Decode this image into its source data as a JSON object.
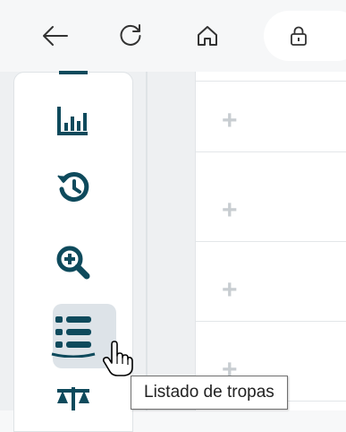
{
  "browser": {
    "icons": {
      "back": "arrow-left-icon",
      "reload": "reload-icon",
      "home": "home-icon",
      "lock": "lock-icon"
    }
  },
  "sidebar": {
    "items": [
      {
        "icon": "bar-chart-icon"
      },
      {
        "icon": "history-icon"
      },
      {
        "icon": "zoom-in-icon"
      },
      {
        "icon": "list-icon",
        "active": true
      },
      {
        "icon": "scale-icon"
      }
    ],
    "accent": "#0e4a5c",
    "active_bg": "#dde3e8"
  },
  "content": {
    "rows": [
      {
        "icon": "plus-icon"
      },
      {
        "icon": "plus-icon"
      },
      {
        "icon": "plus-icon"
      },
      {
        "icon": "plus-icon"
      }
    ]
  },
  "tooltip": {
    "text": "Listado de tropas"
  }
}
